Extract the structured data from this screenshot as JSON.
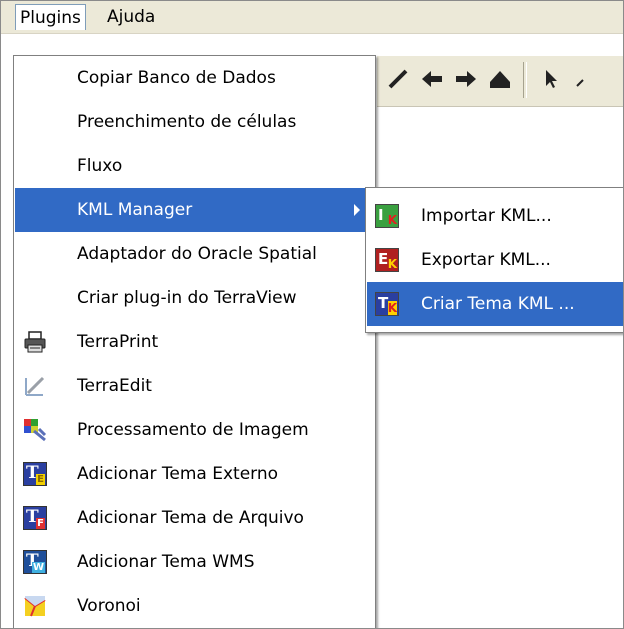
{
  "menubar": {
    "plugins": "Plugins",
    "ajuda": "Ajuda"
  },
  "menu": {
    "items": [
      {
        "label": "Copiar Banco de Dados"
      },
      {
        "label": "Preenchimento de células"
      },
      {
        "label": "Fluxo"
      },
      {
        "label": "KML Manager"
      },
      {
        "label": "Adaptador do Oracle Spatial"
      },
      {
        "label": "Criar plug-in do TerraView"
      },
      {
        "label": "TerraPrint",
        "icon": "printer-icon"
      },
      {
        "label": "TerraEdit",
        "icon": "edit-pen-icon"
      },
      {
        "label": "Processamento de Imagem",
        "icon": "image-processing-icon"
      },
      {
        "label": "Adicionar Tema Externo",
        "icon": "theme-external-icon"
      },
      {
        "label": "Adicionar Tema de Arquivo",
        "icon": "theme-file-icon"
      },
      {
        "label": "Adicionar Tema WMS",
        "icon": "theme-wms-icon"
      },
      {
        "label": "Voronoi",
        "icon": "voronoi-icon"
      }
    ]
  },
  "submenu": {
    "items": [
      {
        "label": "Importar KML...",
        "icon": "import-kml-icon"
      },
      {
        "label": "Exportar KML...",
        "icon": "export-kml-icon"
      },
      {
        "label": "Criar Tema KML ...",
        "icon": "create-theme-kml-icon"
      }
    ]
  },
  "colors": {
    "highlight": "#316ac5",
    "menubar_bg": "#ece9d8"
  }
}
